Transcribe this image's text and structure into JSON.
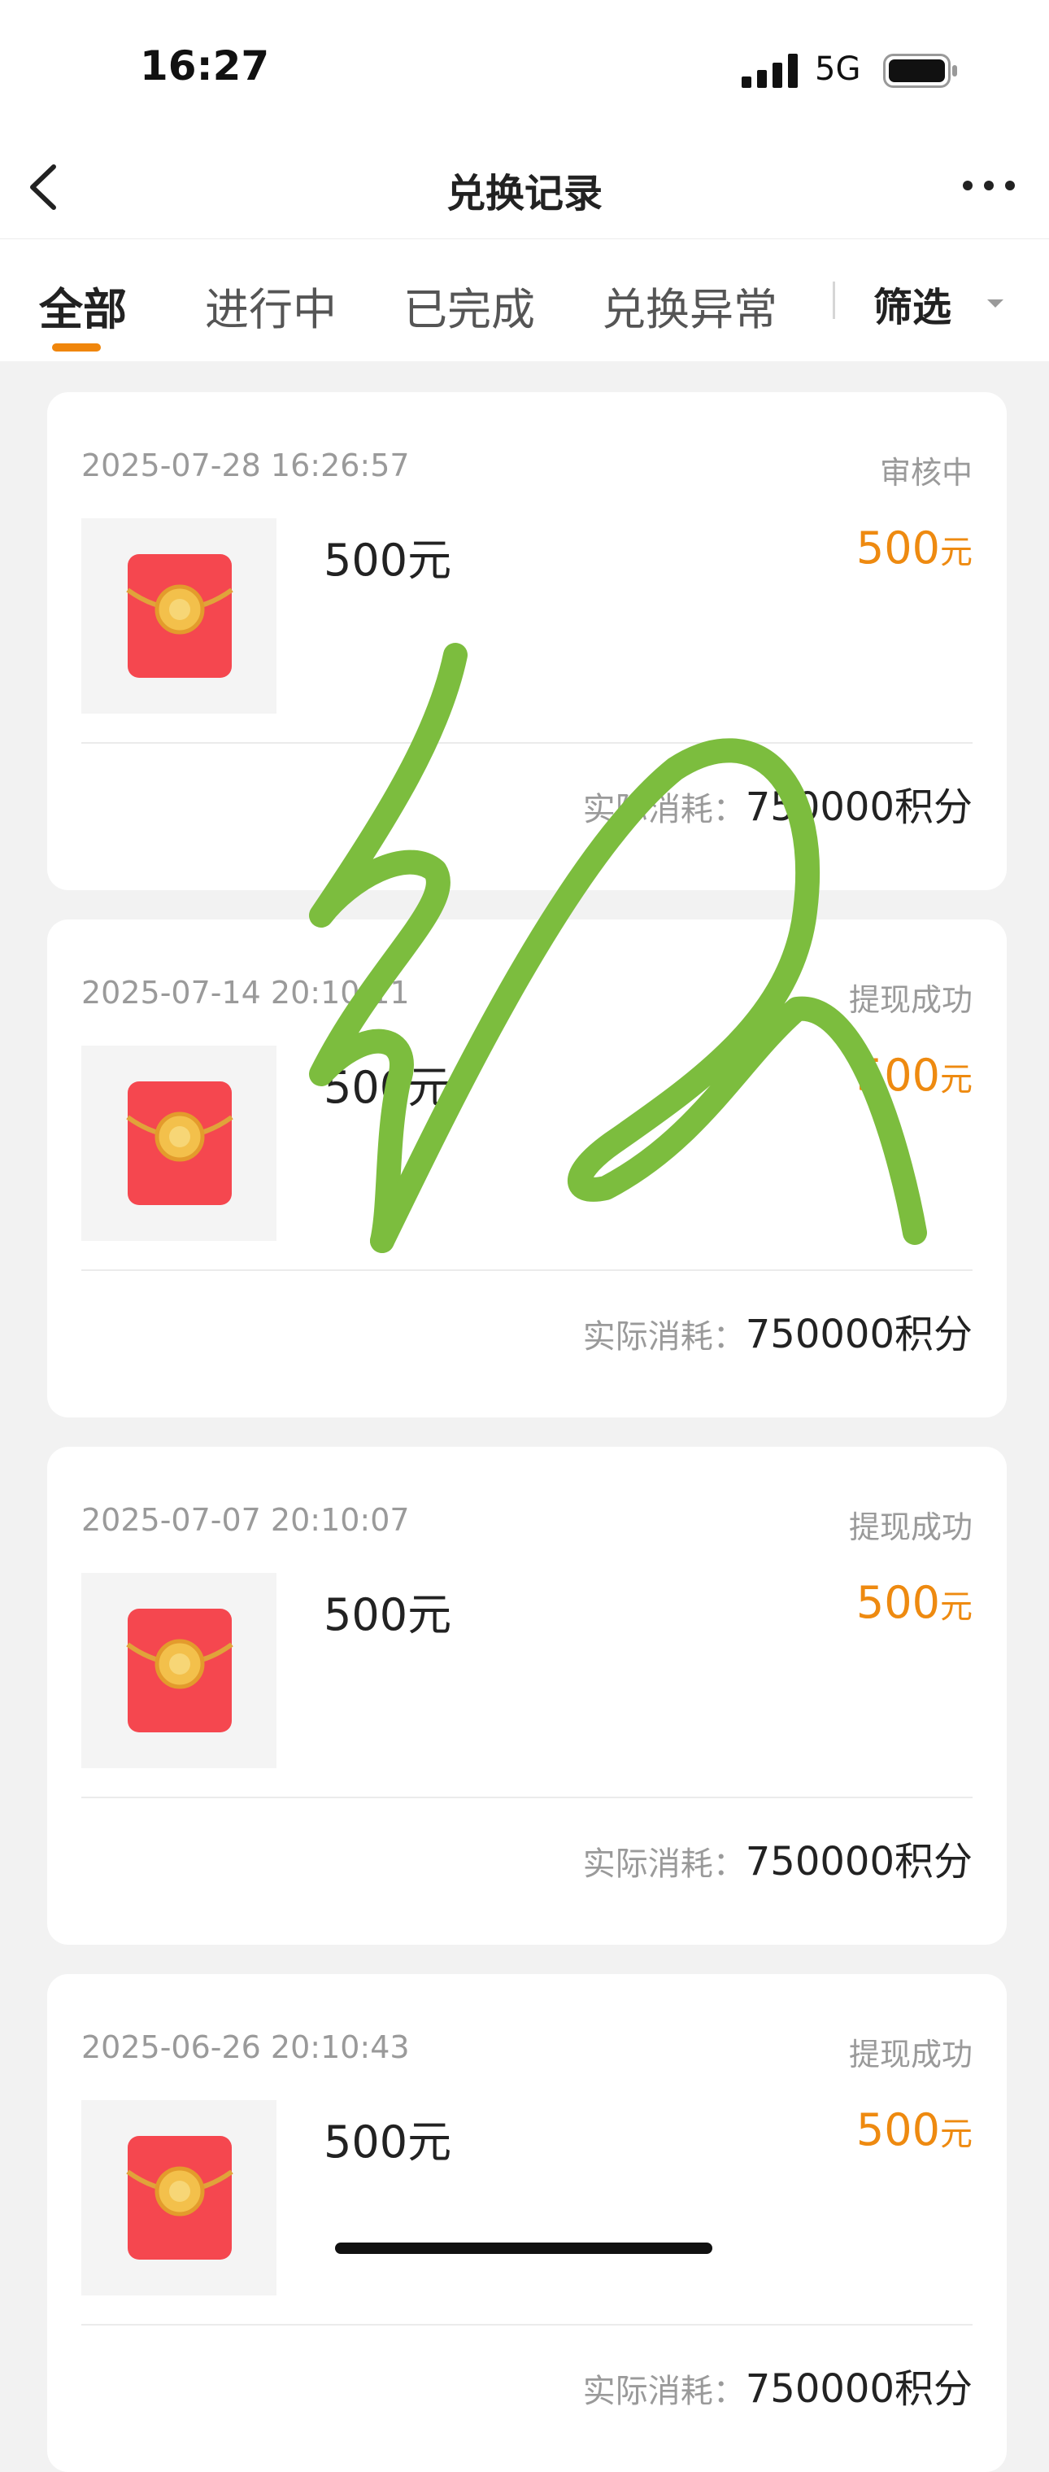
{
  "status_bar": {
    "time": "16:27",
    "network": "5G"
  },
  "header": {
    "title": "兑换记录"
  },
  "tabs": [
    {
      "label": "全部",
      "active": true
    },
    {
      "label": "进行中",
      "active": false
    },
    {
      "label": "已完成",
      "active": false
    },
    {
      "label": "兑换异常",
      "active": false
    }
  ],
  "filter": {
    "label": "筛选"
  },
  "records": [
    {
      "time": "2025-07-28 16:26:57",
      "status": "审核中",
      "name": "500元",
      "price": "500",
      "price_unit": "元",
      "cost_label": "实际消耗：",
      "cost": "750000积分"
    },
    {
      "time": "2025-07-14 20:10:11",
      "status": "提现成功",
      "name": "500元",
      "price": "500",
      "price_unit": "元",
      "cost_label": "实际消耗：",
      "cost": "750000积分"
    },
    {
      "time": "2025-07-07 20:10:07",
      "status": "提现成功",
      "name": "500元",
      "price": "500",
      "price_unit": "元",
      "cost_label": "实际消耗：",
      "cost": "750000积分"
    },
    {
      "time": "2025-06-26 20:10:43",
      "status": "提现成功",
      "name": "500元",
      "price": "500",
      "price_unit": "元",
      "cost_label": "实际消耗：",
      "cost": "750000积分"
    }
  ],
  "colors": {
    "accent": "#f0860c",
    "price": "#ee8a10",
    "scribble": "#7cbd3e",
    "envelope": "#f5474f"
  },
  "icons": {
    "back": "chevron-left-icon",
    "more": "more-dots-icon",
    "filter_arrow": "caret-down-icon",
    "thumbnail": "red-envelope-icon"
  }
}
